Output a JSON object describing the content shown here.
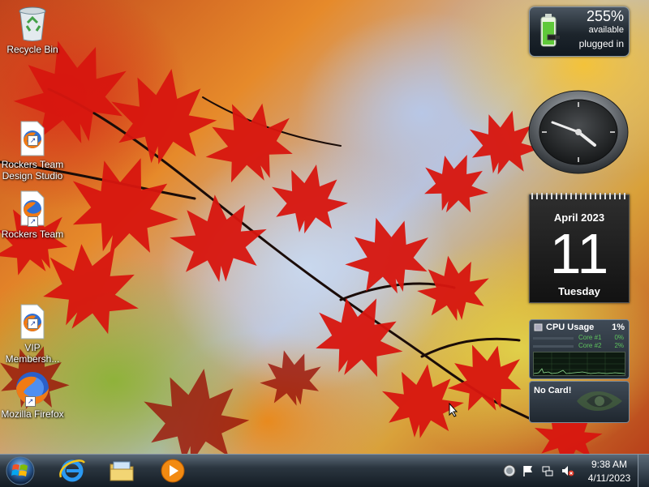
{
  "desktop": {
    "icons": [
      {
        "label": "Recycle Bin",
        "icon": "recycle-bin-icon"
      },
      {
        "label": "Rockers Team\nDesign Studio",
        "icon": "firefox-html-file-icon"
      },
      {
        "label": "Rockers Team",
        "icon": "firefox-html-file-icon"
      },
      {
        "label": "VIP\nMembersh...",
        "icon": "firefox-html-file-icon"
      },
      {
        "label": "Mozilla Firefox",
        "icon": "firefox-icon"
      }
    ]
  },
  "gadgets": {
    "battery": {
      "percent": "255%",
      "status": "available",
      "power": "plugged in"
    },
    "clock": {
      "time": "9:38"
    },
    "calendar": {
      "month": "April 2023",
      "day": "11",
      "weekday": "Tuesday"
    },
    "cpu": {
      "title": "CPU Usage",
      "total": "1%",
      "cores": [
        {
          "label": "Core #1",
          "value": "0%"
        },
        {
          "label": "Core #2",
          "value": "2%"
        }
      ]
    },
    "gpu": {
      "message": "No Card!"
    }
  },
  "taskbar": {
    "start": "windows-orb-icon",
    "pinned": [
      "internet-explorer-icon",
      "windows-explorer-icon",
      "media-player-icon"
    ],
    "tray_icons": [
      "power-icon",
      "action-center-flag-icon",
      "network-icon",
      "volume-muted-icon"
    ],
    "clock": {
      "time": "9:38 AM",
      "date": "4/11/2023"
    }
  },
  "colors": {
    "taskbar": "#2b3640",
    "accent_leaf": "#d8160f",
    "cpu_green": "#5ec25e"
  }
}
